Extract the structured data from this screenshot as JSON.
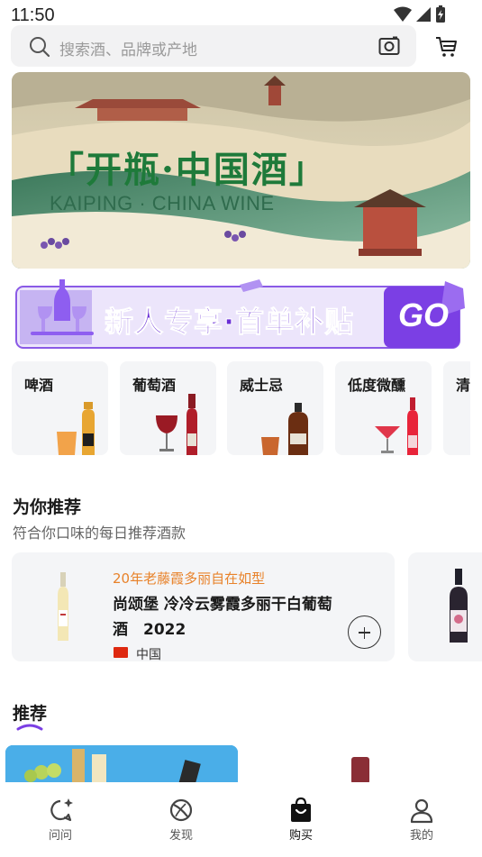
{
  "status_bar": {
    "time": "11:50"
  },
  "search": {
    "placeholder": "搜索酒、品牌或产地"
  },
  "banner": {
    "title": "「开瓶·中国酒」",
    "subtitle": "KAIPING · CHINA WINE"
  },
  "promo": {
    "label": "新人专享·首单补贴",
    "go": "GO"
  },
  "categories": [
    {
      "label": "啤酒"
    },
    {
      "label": "葡萄酒"
    },
    {
      "label": "威士忌"
    },
    {
      "label": "低度微醺"
    },
    {
      "label": "清"
    }
  ],
  "recommend_section": {
    "title": "为你推荐",
    "subtitle": "符合你口味的每日推荐酒款",
    "card": {
      "tag": "20年老藤霞多丽自在如型",
      "name": "尚颂堡 冷冷云雾霞多丽干白葡萄酒　2022",
      "origin": "中国"
    }
  },
  "feed": {
    "title": "推荐"
  },
  "bottom_nav": [
    {
      "label": "问问",
      "icon": "chat-sparkle-icon"
    },
    {
      "label": "发现",
      "icon": "discover-icon"
    },
    {
      "label": "购买",
      "icon": "shopping-bag-icon"
    },
    {
      "label": "我的",
      "icon": "profile-icon"
    }
  ],
  "colors": {
    "accent": "#7b3fe4",
    "tag": "#e8822a",
    "brand_green": "#1e7a3a"
  }
}
